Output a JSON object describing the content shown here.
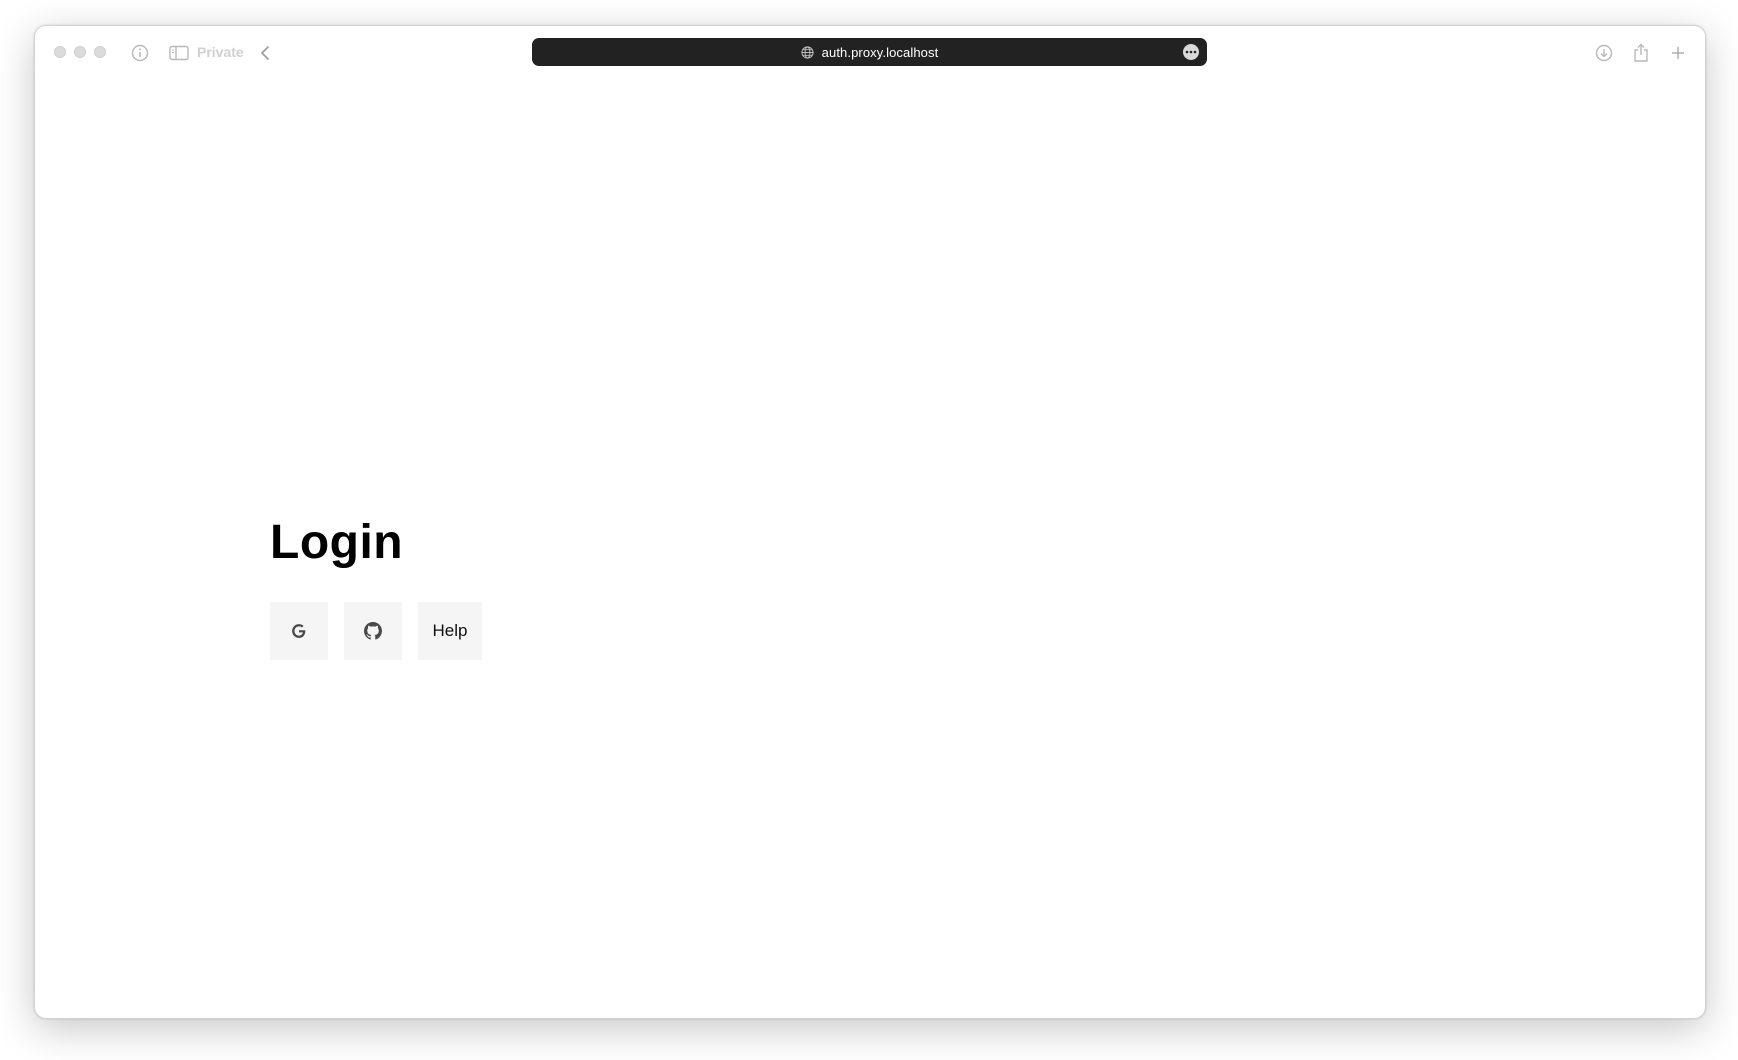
{
  "browser": {
    "private_label": "Private",
    "url": "auth.proxy.localhost"
  },
  "page": {
    "title": "Login",
    "buttons": {
      "google_icon": "google-icon",
      "github_icon": "github-icon",
      "help_label": "Help"
    }
  },
  "colors": {
    "address_bar": "#222222",
    "button_bg": "#f5f5f5",
    "title": "#000000"
  }
}
